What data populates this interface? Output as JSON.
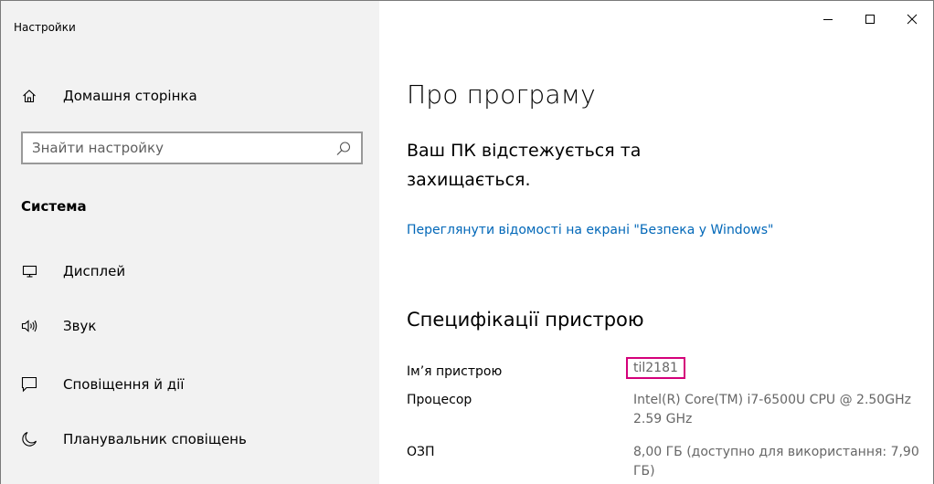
{
  "window": {
    "title": "Настройки",
    "controls": {
      "minimize": "minimize",
      "maximize": "maximize",
      "close": "close"
    }
  },
  "sidebar": {
    "home": {
      "label": "Домашня сторінка",
      "icon": "home-icon"
    },
    "search": {
      "placeholder": "Знайти настройку",
      "icon": "search-icon"
    },
    "section_heading": "Система",
    "items": [
      {
        "label": "Дисплей",
        "icon": "display-icon"
      },
      {
        "label": "Звук",
        "icon": "speaker-icon"
      },
      {
        "label": "Сповіщення й дії",
        "icon": "notification-icon"
      },
      {
        "label": "Планувальник сповіщень",
        "icon": "moon-icon"
      }
    ]
  },
  "main": {
    "title": "Про програму",
    "protection_message": "Ваш ПК відстежується та захищається.",
    "security_link": "Переглянути відомості на екрані \"Безпека у Windows\"",
    "specs_heading": "Специфікації пристрою",
    "specs": [
      {
        "key": "Ім’я пристрою",
        "value": "til2181"
      },
      {
        "key": "Процесор",
        "value": "Intel(R) Core(TM) i7-6500U CPU @ 2.50GHz   2.59 GHz"
      },
      {
        "key": "ОЗП",
        "value": "8,00 ГБ (доступно для використання: 7,90 ГБ)"
      }
    ]
  },
  "colors": {
    "sidebar_bg": "#f2f2f2",
    "link": "#0067b8",
    "highlight_border": "#d4007a",
    "value_text": "#666666"
  }
}
